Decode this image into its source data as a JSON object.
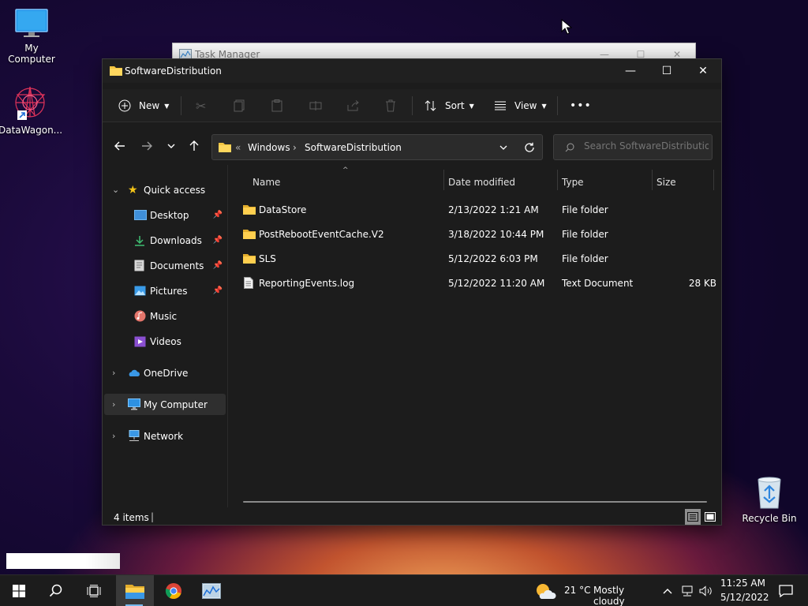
{
  "desktop": {
    "icons": [
      {
        "label": "My Computer",
        "icon": "monitor-icon"
      },
      {
        "label": "DataWagon...",
        "icon": "datawagon-app-icon"
      },
      {
        "label": "Recycle Bin",
        "icon": "recycle-bin-icon"
      }
    ]
  },
  "background_window": {
    "title": "Task Manager"
  },
  "explorer": {
    "title": "SoftwareDistribution",
    "toolbar": {
      "new_label": "New",
      "sort_label": "Sort",
      "view_label": "View",
      "more_label": "•••"
    },
    "address": {
      "overflow": "«",
      "crumbs": [
        "Windows",
        "SoftwareDistribution"
      ]
    },
    "search": {
      "placeholder": "Search SoftwareDistribution"
    },
    "nav": {
      "quick_access": "Quick access",
      "items": [
        {
          "label": "Desktop",
          "pinned": true,
          "icon": "desktop-folder-icon"
        },
        {
          "label": "Downloads",
          "pinned": true,
          "icon": "downloads-icon"
        },
        {
          "label": "Documents",
          "pinned": true,
          "icon": "documents-icon"
        },
        {
          "label": "Pictures",
          "pinned": true,
          "icon": "pictures-icon"
        },
        {
          "label": "Music",
          "pinned": false,
          "icon": "music-icon"
        },
        {
          "label": "Videos",
          "pinned": false,
          "icon": "videos-icon"
        }
      ],
      "onedrive": "OneDrive",
      "my_computer": "My Computer",
      "network": "Network"
    },
    "columns": {
      "name": "Name",
      "date": "Date modified",
      "type": "Type",
      "size": "Size"
    },
    "files": [
      {
        "name": "DataStore",
        "date": "2/13/2022 1:21 AM",
        "type": "File folder",
        "size": "",
        "icon": "folder-icon"
      },
      {
        "name": "PostRebootEventCache.V2",
        "date": "3/18/2022 10:44 PM",
        "type": "File folder",
        "size": "",
        "icon": "folder-icon"
      },
      {
        "name": "SLS",
        "date": "5/12/2022 6:03 PM",
        "type": "File folder",
        "size": "",
        "icon": "folder-icon"
      },
      {
        "name": "ReportingEvents.log",
        "date": "5/12/2022 11:20 AM",
        "type": "Text Document",
        "size": "28 KB",
        "icon": "text-document-icon"
      }
    ],
    "status": {
      "count": "4 items",
      "separator": "|"
    }
  },
  "taskbar": {
    "weather": {
      "temp": "21 °C",
      "condition": "Mostly cloudy"
    },
    "clock": {
      "time": "11:25 AM",
      "date": "5/12/2022"
    }
  },
  "colors": {
    "accent": "#76b9ed",
    "folder": "#f4c542",
    "window_bg": "#1c1c1c"
  }
}
